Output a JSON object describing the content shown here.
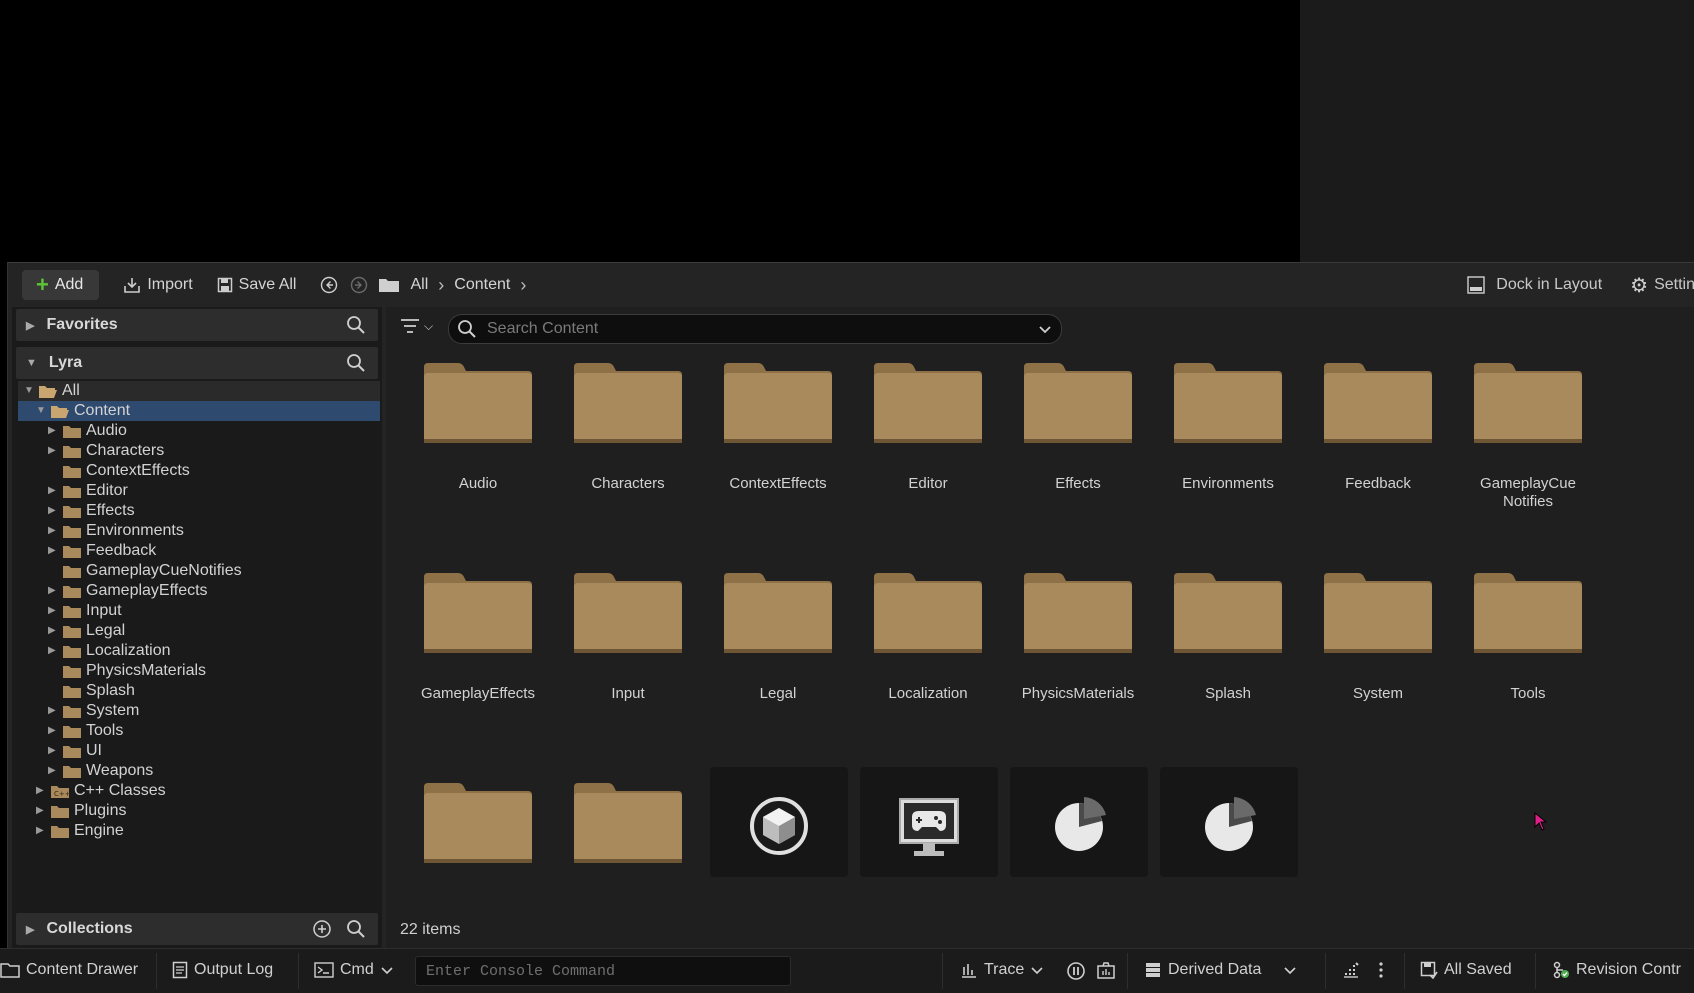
{
  "toolbar": {
    "add_label": "Add",
    "import_label": "Import",
    "save_all_label": "Save All",
    "breadcrumb": [
      "All",
      "Content"
    ],
    "dock_label": "Dock in Layout",
    "settings_label": "Settin"
  },
  "sources": {
    "favorites_label": "Favorites",
    "lyra_label": "Lyra",
    "collections_label": "Collections",
    "tree": [
      {
        "label": "All",
        "depth": 0,
        "expanded": true,
        "type": "open"
      },
      {
        "label": "Content",
        "depth": 1,
        "expanded": true,
        "type": "open",
        "selected": true
      },
      {
        "label": "Audio",
        "depth": 2,
        "arrow": true
      },
      {
        "label": "Characters",
        "depth": 2,
        "arrow": true
      },
      {
        "label": "ContextEffects",
        "depth": 2,
        "arrow": false
      },
      {
        "label": "Editor",
        "depth": 2,
        "arrow": true
      },
      {
        "label": "Effects",
        "depth": 2,
        "arrow": true
      },
      {
        "label": "Environments",
        "depth": 2,
        "arrow": true
      },
      {
        "label": "Feedback",
        "depth": 2,
        "arrow": true
      },
      {
        "label": "GameplayCueNotifies",
        "depth": 2,
        "arrow": false
      },
      {
        "label": "GameplayEffects",
        "depth": 2,
        "arrow": true
      },
      {
        "label": "Input",
        "depth": 2,
        "arrow": true
      },
      {
        "label": "Legal",
        "depth": 2,
        "arrow": true
      },
      {
        "label": "Localization",
        "depth": 2,
        "arrow": true
      },
      {
        "label": "PhysicsMaterials",
        "depth": 2,
        "arrow": false
      },
      {
        "label": "Splash",
        "depth": 2,
        "arrow": false
      },
      {
        "label": "System",
        "depth": 2,
        "arrow": true
      },
      {
        "label": "Tools",
        "depth": 2,
        "arrow": true
      },
      {
        "label": "UI",
        "depth": 2,
        "arrow": true
      },
      {
        "label": "Weapons",
        "depth": 2,
        "arrow": true
      },
      {
        "label": "C++ Classes",
        "depth": 1,
        "arrow": true,
        "type": "cpp"
      },
      {
        "label": "Plugins",
        "depth": 1,
        "arrow": true
      },
      {
        "label": "Engine",
        "depth": 1,
        "arrow": true
      }
    ]
  },
  "content": {
    "search_placeholder": "Search Content",
    "folders": [
      "Audio",
      "Characters",
      "ContextEffects",
      "Editor",
      "Effects",
      "Environments",
      "Feedback",
      "GameplayCue Notifies",
      "GameplayEffects",
      "Input",
      "Legal",
      "Localization",
      "PhysicsMaterials",
      "Splash",
      "System",
      "Tools"
    ],
    "bottom_row": [
      "folder",
      "folder",
      "mesh-cube-icon",
      "game-mode-icon",
      "data-asset-icon",
      "data-asset-icon"
    ],
    "item_count": "22 items"
  },
  "bottom_bar": {
    "content_drawer": "Content Drawer",
    "output_log": "Output Log",
    "cmd": "Cmd",
    "console_placeholder": "Enter Console Command",
    "trace": "Trace",
    "derived_data": "Derived Data",
    "all_saved": "All Saved",
    "revision_control": "Revision Contr"
  },
  "colors": {
    "folder": "#a98a5c",
    "selection": "#2e4a6e",
    "add_plus": "#5ec437"
  }
}
